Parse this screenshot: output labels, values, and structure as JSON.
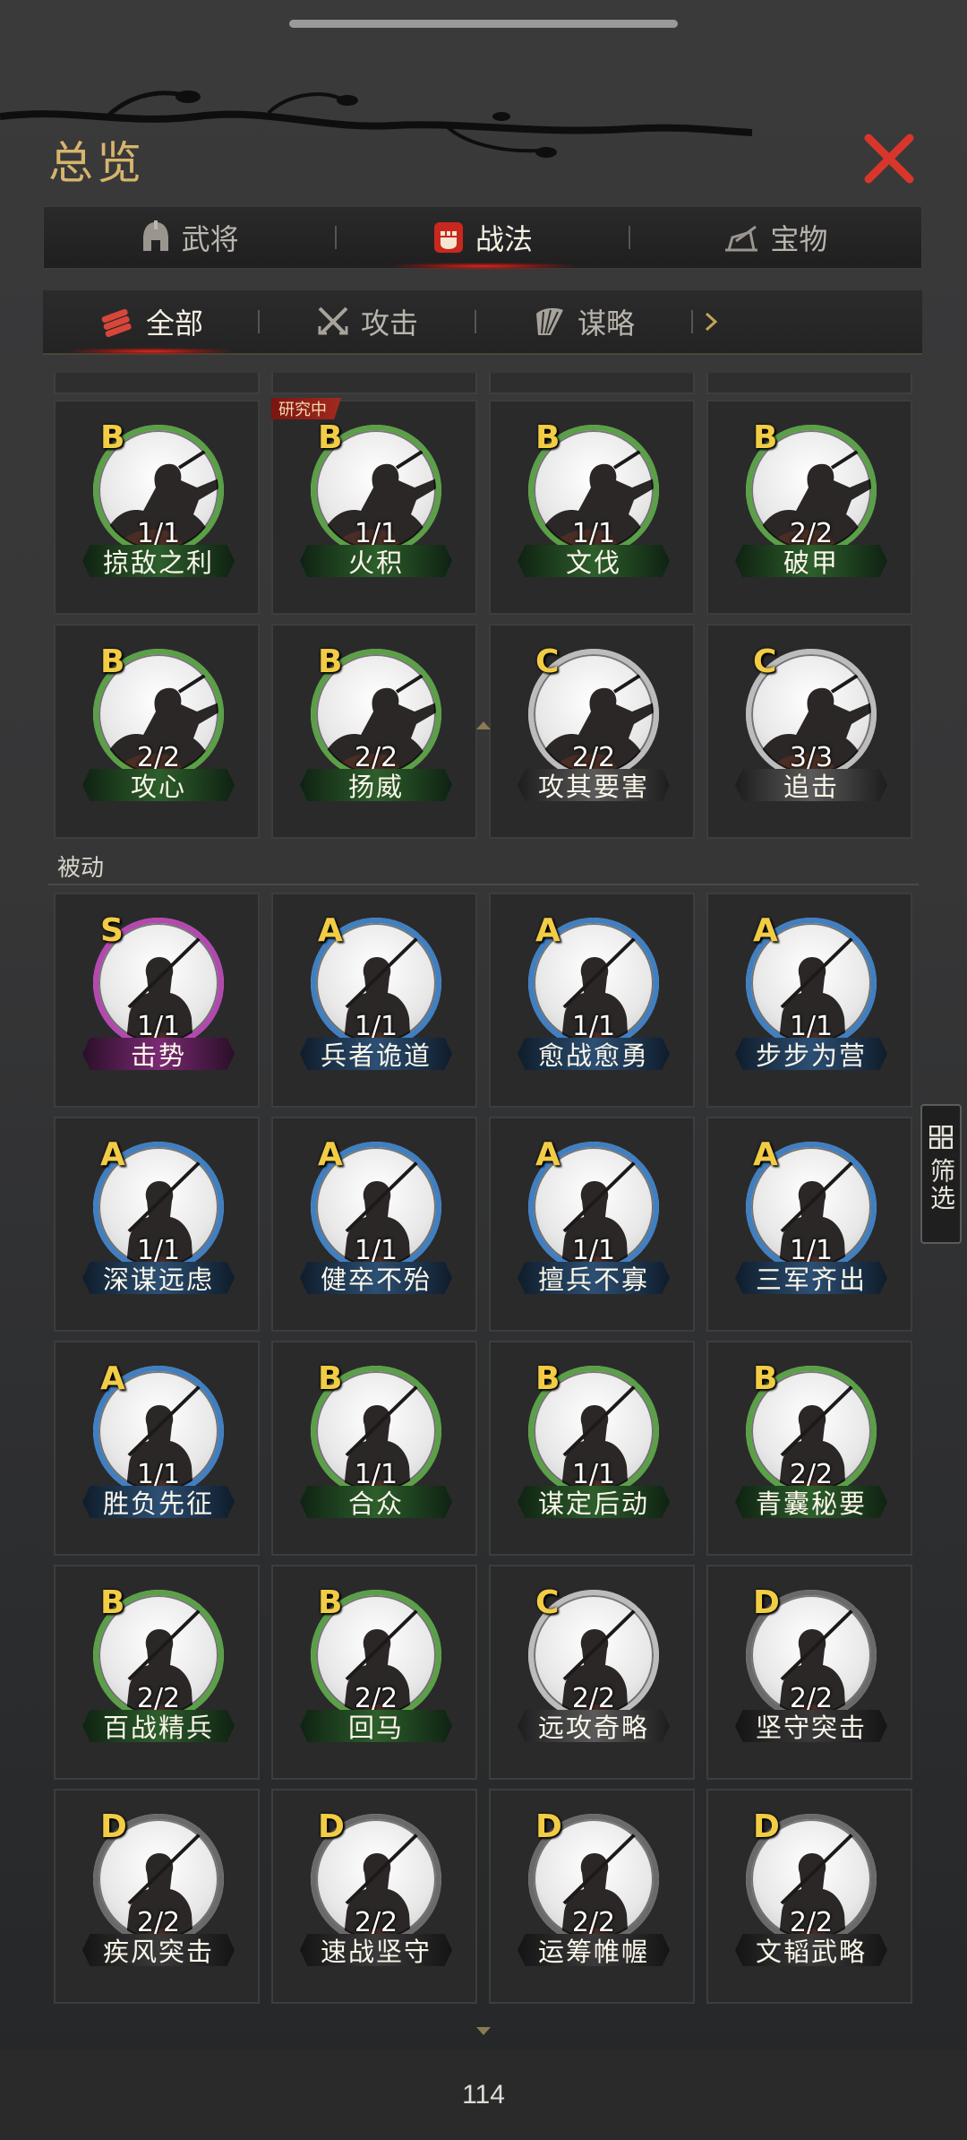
{
  "header": {
    "title": "总览",
    "close_icon": "close-icon"
  },
  "tabs": [
    {
      "label": "武将",
      "icon": "helmet-icon",
      "active": false
    },
    {
      "label": "战法",
      "icon": "fist-icon",
      "active": true
    },
    {
      "label": "宝物",
      "icon": "treasure-icon",
      "active": false
    }
  ],
  "subtabs": [
    {
      "label": "全部",
      "icon": "scroll-bundle-icon",
      "active": true
    },
    {
      "label": "攻击",
      "icon": "crossed-swords-icon",
      "active": false
    },
    {
      "label": "谋略",
      "icon": "feather-fan-icon",
      "active": false
    }
  ],
  "colors": {
    "grade_S": "#b547b0",
    "grade_A": "#3f7fc2",
    "grade_B": "#5aa046",
    "grade_C": "#bcbcbc",
    "grade_D": "#6a6a6a",
    "grade_letter": "#f2cc45",
    "accent_red": "#d42a1e"
  },
  "active_section": {
    "research_tag": "研究中",
    "cards": [
      {
        "grade": "B",
        "level": "1/1",
        "name": "掠敌之利",
        "research": false
      },
      {
        "grade": "B",
        "level": "1/1",
        "name": "火积",
        "research": true
      },
      {
        "grade": "B",
        "level": "1/1",
        "name": "文伐",
        "research": false
      },
      {
        "grade": "B",
        "level": "2/2",
        "name": "破甲",
        "research": false
      },
      {
        "grade": "B",
        "level": "2/2",
        "name": "攻心",
        "research": false
      },
      {
        "grade": "B",
        "level": "2/2",
        "name": "扬威",
        "research": false
      },
      {
        "grade": "C",
        "level": "2/2",
        "name": "攻其要害",
        "research": false
      },
      {
        "grade": "C",
        "level": "3/3",
        "name": "追击",
        "research": false
      }
    ]
  },
  "passive_section": {
    "label": "被动",
    "cards": [
      {
        "grade": "S",
        "level": "1/1",
        "name": "击势"
      },
      {
        "grade": "A",
        "level": "1/1",
        "name": "兵者诡道"
      },
      {
        "grade": "A",
        "level": "1/1",
        "name": "愈战愈勇"
      },
      {
        "grade": "A",
        "level": "1/1",
        "name": "步步为营"
      },
      {
        "grade": "A",
        "level": "1/1",
        "name": "深谋远虑"
      },
      {
        "grade": "A",
        "level": "1/1",
        "name": "健卒不殆"
      },
      {
        "grade": "A",
        "level": "1/1",
        "name": "擅兵不寡"
      },
      {
        "grade": "A",
        "level": "1/1",
        "name": "三军齐出"
      },
      {
        "grade": "A",
        "level": "1/1",
        "name": "胜负先征"
      },
      {
        "grade": "B",
        "level": "1/1",
        "name": "合众"
      },
      {
        "grade": "B",
        "level": "1/1",
        "name": "谋定后动"
      },
      {
        "grade": "B",
        "level": "2/2",
        "name": "青囊秘要"
      },
      {
        "grade": "B",
        "level": "2/2",
        "name": "百战精兵"
      },
      {
        "grade": "B",
        "level": "2/2",
        "name": "回马"
      },
      {
        "grade": "C",
        "level": "2/2",
        "name": "远攻奇略"
      },
      {
        "grade": "D",
        "level": "2/2",
        "name": "坚守突击"
      },
      {
        "grade": "D",
        "level": "2/2",
        "name": "疾风突击"
      },
      {
        "grade": "D",
        "level": "2/2",
        "name": "速战坚守"
      },
      {
        "grade": "D",
        "level": "2/2",
        "name": "运筹帷幄"
      },
      {
        "grade": "D",
        "level": "2/2",
        "name": "文韬武略"
      }
    ]
  },
  "filter": {
    "label": "筛选",
    "icon": "grid-icon"
  },
  "footer": {
    "count": "114"
  }
}
